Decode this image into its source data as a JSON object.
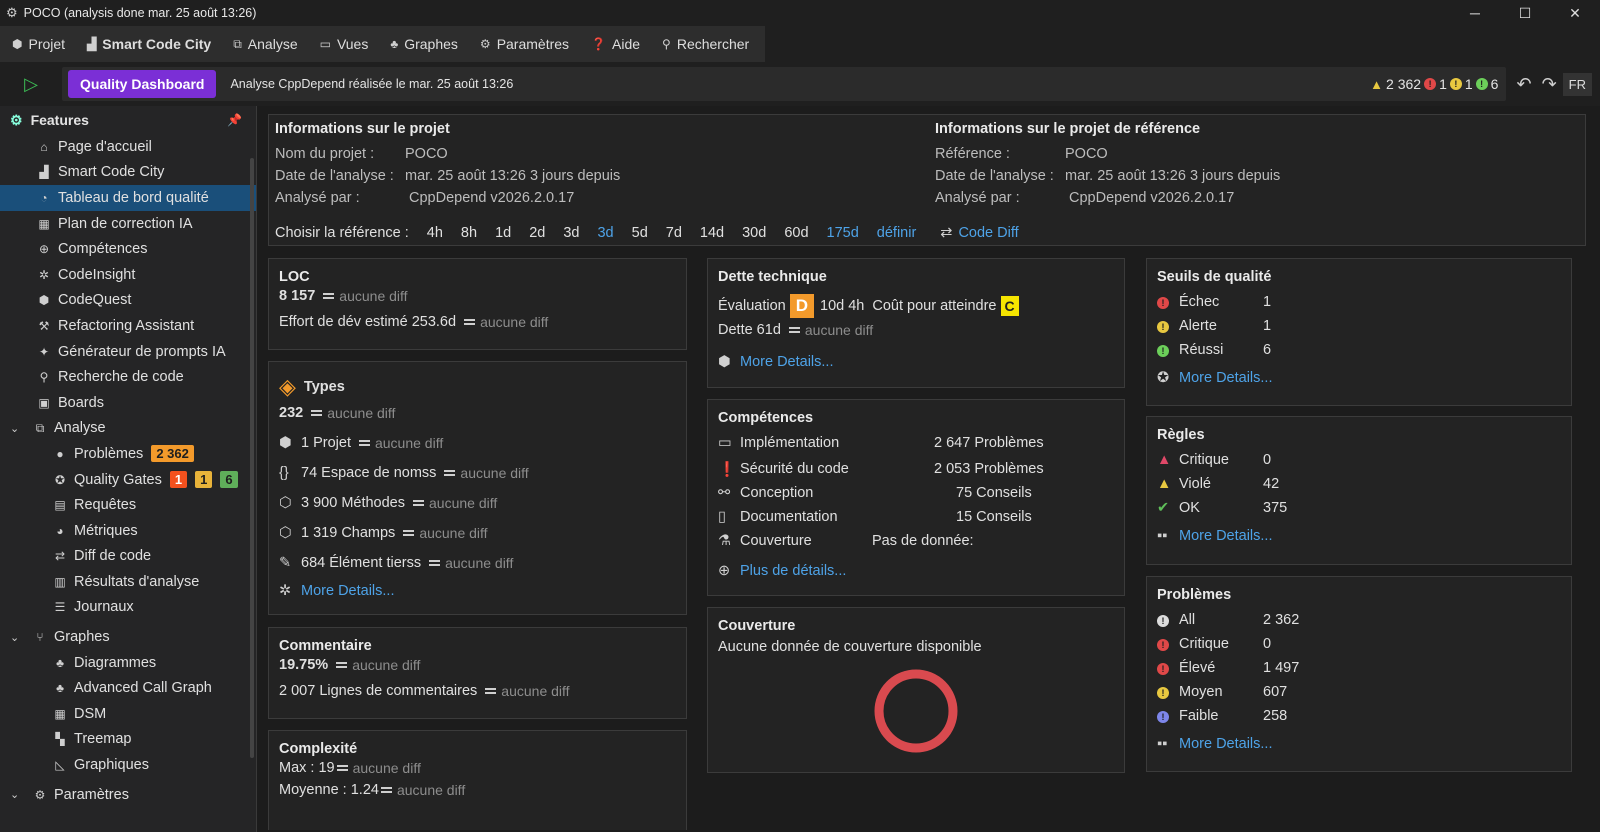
{
  "titlebar": {
    "title": "POCO (analysis done mar. 25 août  13:26)"
  },
  "menu": [
    "Projet",
    "Smart Code City",
    "Analyse",
    "Vues",
    "Graphes",
    "Paramètres",
    "Aide",
    "Rechercher"
  ],
  "toolbar": {
    "qd_label": "Quality Dashboard",
    "message": "Analyse CppDepend réalisée le mar. 25 août  13:26",
    "warn_count": "2 362",
    "red": "1",
    "yellow": "1",
    "green": "6",
    "lang": "FR"
  },
  "sidebar": {
    "title": "Features",
    "items": [
      "Page d'accueil",
      "Smart Code City",
      "Tableau de bord qualité",
      "Plan de correction IA",
      "Compétences",
      "CodeInsight",
      "CodeQuest",
      "Refactoring Assistant",
      "Générateur de prompts IA",
      "Recherche de code",
      "Boards"
    ],
    "analyse": {
      "label": "Analyse",
      "items": [
        "Problèmes",
        "Quality Gates",
        "Requêtes",
        "Métriques",
        "Diff de code",
        "Résultats d'analyse",
        "Journaux"
      ],
      "problems_badge": "2 362",
      "gates": [
        "1",
        "1",
        "6"
      ]
    },
    "graphes": {
      "label": "Graphes",
      "items": [
        "Diagrammes",
        "Advanced Call Graph",
        "DSM",
        "Treemap",
        "Graphiques"
      ]
    },
    "params": "Paramètres"
  },
  "project": {
    "title": "Informations sur le projet",
    "name_label": "Nom du projet :",
    "name": "POCO",
    "date_label": "Date de l'analyse :",
    "date": "mar. 25 août  13:26 3 jours depuis",
    "by_label": "Analysé par :",
    "by": "CppDepend v2026.2.0.17"
  },
  "reference": {
    "title": "Informations sur le projet de référence",
    "ref_label": "Référence :",
    "ref": "POCO",
    "date_label": "Date de l'analyse :",
    "date": "mar. 25 août  13:26 3 jours depuis",
    "by_label": "Analysé par :",
    "by": "CppDepend v2026.2.0.17"
  },
  "choose": {
    "label": "Choisir la référence :",
    "options": [
      "4h",
      "8h",
      "1d",
      "2d",
      "3d",
      "3d",
      "5d",
      "7d",
      "14d",
      "30d",
      "60d",
      "175d",
      "définir"
    ],
    "code_diff": "Code Diff"
  },
  "nodiff": "aucune diff",
  "loc": {
    "title": "LOC",
    "value": "8 157",
    "effort": "Effort de dév estimé 253.6d"
  },
  "types": {
    "title": "Types",
    "count": "232",
    "rows": [
      "1 Projet",
      "74 Espace de nomss",
      "3 900 Méthodes",
      "1 319 Champs",
      "684 Élément tierss"
    ],
    "more": "More Details..."
  },
  "comment": {
    "title": "Commentaire",
    "pct": "19.75%",
    "lines": "2 007 Lignes de commentaires"
  },
  "complexity": {
    "title": "Complexité",
    "max": "Max : 19",
    "avg": "Moyenne : 1.24"
  },
  "debt": {
    "title": "Dette technique",
    "eval_label": "Évaluation",
    "grade": "D",
    "time": "10d  4h",
    "cost_label": "Coût pour atteindre",
    "target": "C",
    "debt": "Dette 61d",
    "more": "More Details..."
  },
  "skills": {
    "title": "Compétences",
    "rows": [
      {
        "label": "Implémentation",
        "value": "2 647 Problèmes"
      },
      {
        "label": "Sécurité du code",
        "value": "2 053 Problèmes"
      },
      {
        "label": "Conception",
        "value": "75 Conseils"
      },
      {
        "label": "Documentation",
        "value": "15 Conseils"
      },
      {
        "label": "Couverture",
        "value": "Pas de donnée:"
      }
    ],
    "more": "Plus de détails..."
  },
  "coverage": {
    "title": "Couverture",
    "text": "Aucune donnée de couverture disponible"
  },
  "gates": {
    "title": "Seuils de qualité",
    "rows": [
      {
        "label": "Échec",
        "value": "1"
      },
      {
        "label": "Alerte",
        "value": "1"
      },
      {
        "label": "Réussi",
        "value": "6"
      }
    ],
    "more": "More Details..."
  },
  "rules": {
    "title": "Règles",
    "rows": [
      {
        "label": "Critique",
        "value": "0"
      },
      {
        "label": "Violé",
        "value": "42"
      },
      {
        "label": "OK",
        "value": "375"
      }
    ],
    "more": "More Details..."
  },
  "problems": {
    "title": "Problèmes",
    "rows": [
      {
        "label": "All",
        "value": "2 362"
      },
      {
        "label": "Critique",
        "value": "0"
      },
      {
        "label": "Élevé",
        "value": "1 497"
      },
      {
        "label": "Moyen",
        "value": "607"
      },
      {
        "label": "Faible",
        "value": "258"
      }
    ],
    "more": "More Details..."
  },
  "colors": {
    "accent": "#7b2fd6",
    "link": "#4ea3e8",
    "selected": "#1a4f7a",
    "gradeD": "#f39a2b",
    "gradeC": "#f5e400",
    "ring": "#d94a4f"
  }
}
